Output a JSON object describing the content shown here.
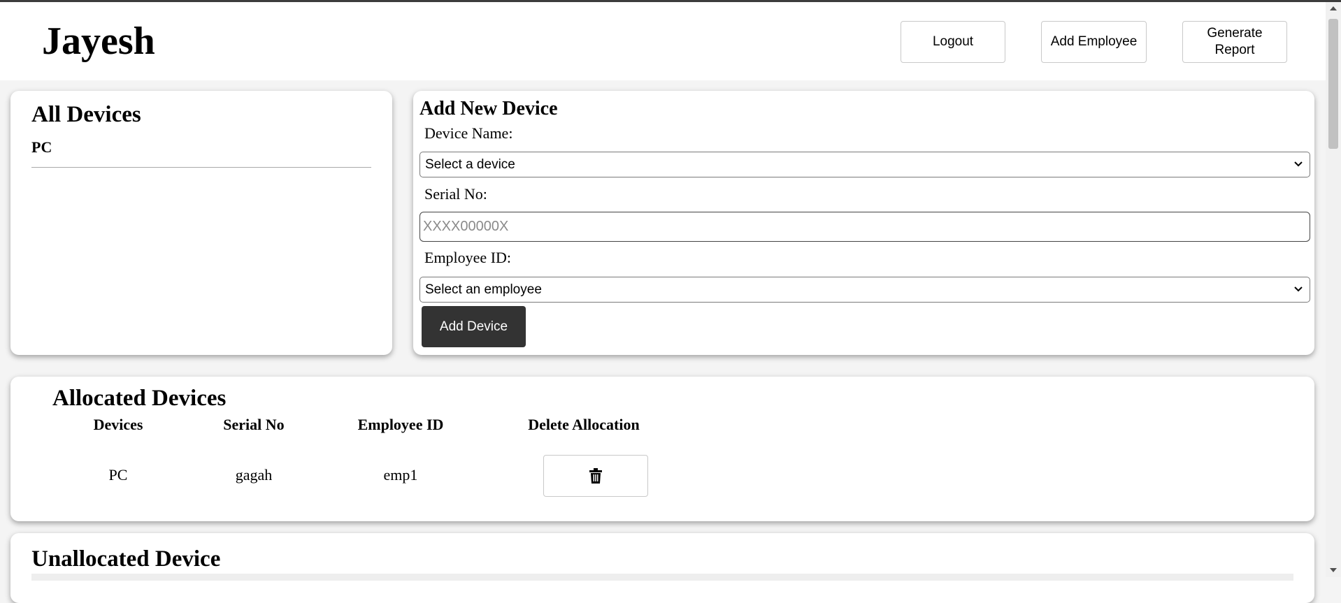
{
  "header": {
    "brand": "Jayesh",
    "buttons": {
      "logout": "Logout",
      "add_employee": "Add Employee",
      "generate_report": "Generate Report"
    }
  },
  "all_devices": {
    "title": "All Devices",
    "items": [
      "PC"
    ]
  },
  "add_device": {
    "title": "Add New Device",
    "device_name_label": "Device Name:",
    "device_select_value": "Select a device",
    "serial_label": "Serial No:",
    "serial_placeholder": "XXXX00000X",
    "serial_value": "",
    "employee_label": "Employee ID:",
    "employee_select_value": "Select an employee",
    "submit_label": "Add Device"
  },
  "allocated": {
    "title": "Allocated Devices",
    "columns": [
      "Devices",
      "Serial No",
      "Employee ID",
      "Delete Allocation"
    ],
    "rows": [
      {
        "device": "PC",
        "serial": "gagah",
        "employee": "emp1",
        "action_icon": "trash-icon"
      }
    ]
  },
  "unallocated": {
    "title": "Unallocated Device"
  },
  "colors": {
    "primary_button": "#333333",
    "background": "#f4f4f4",
    "card": "#ffffff"
  }
}
